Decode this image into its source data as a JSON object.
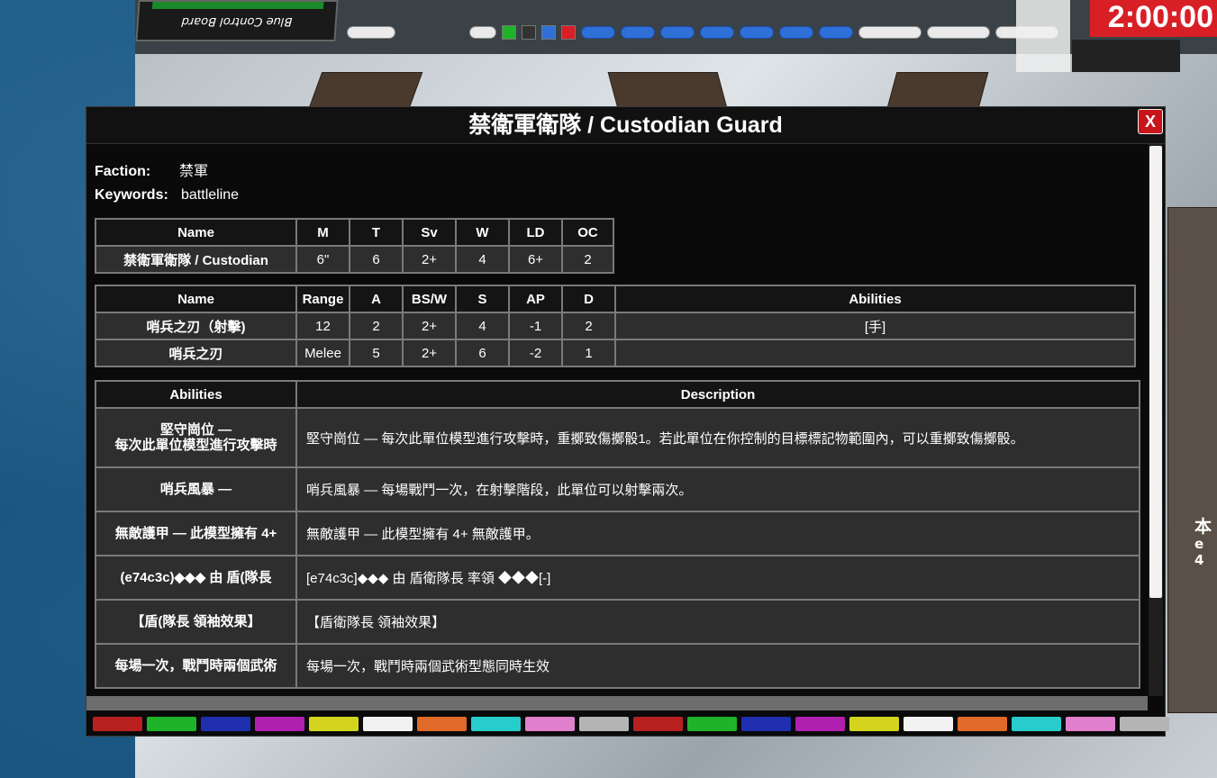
{
  "scene": {
    "control_board_label": "Blue Control Board",
    "timer": "2:00:00",
    "toolbar_pills": [
      "",
      "",
      "",
      "",
      "",
      ""
    ]
  },
  "modal": {
    "title": "禁衛軍衛隊 / Custodian Guard",
    "close_label": "X",
    "faction": {
      "key": "Faction:",
      "value": "禁軍"
    },
    "keywords": {
      "key": "Keywords:",
      "value": "battleline"
    },
    "profile_table": {
      "headers": [
        "Name",
        "M",
        "T",
        "Sv",
        "W",
        "LD",
        "OC"
      ],
      "rows": [
        [
          "禁衛軍衛隊 / Custodian",
          "6\"",
          "6",
          "2+",
          "4",
          "6+",
          "2"
        ]
      ]
    },
    "weapons_table": {
      "headers": [
        "Name",
        "Range",
        "A",
        "BS/W",
        "S",
        "AP",
        "D",
        "Abilities"
      ],
      "rows": [
        [
          "哨兵之刃（射擊)",
          "12",
          "2",
          "2+",
          "4",
          "-1",
          "2",
          "[手]"
        ],
        [
          "哨兵之刃",
          "Melee",
          "5",
          "2+",
          "6",
          "-2",
          "1",
          ""
        ]
      ]
    },
    "abilities_table": {
      "headers": [
        "Abilities",
        "Description"
      ],
      "rows": [
        {
          "name": "堅守崗位 —\n每次此單位模型進行攻擊時",
          "desc": "堅守崗位 — 每次此單位模型進行攻擊時，重擲致傷擲骰1。若此單位在你控制的目標標記物範圍內，可以重擲致傷擲骰。"
        },
        {
          "name": "哨兵風暴 —",
          "desc": "哨兵風暴 — 每場戰鬥一次，在射擊階段，此單位可以射擊兩次。"
        },
        {
          "name": "無敵護甲 — 此模型擁有 4+",
          "desc": "無敵護甲 — 此模型擁有 4+ 無敵護甲。"
        },
        {
          "name": "(e74c3c)◆◆◆ 由 盾(隊長",
          "desc": "[e74c3c]◆◆◆ 由 盾衛隊長 率領 ◆◆◆[-]"
        },
        {
          "name": "【盾(隊長 領袖效果】",
          "desc": "【盾衛隊長 領袖效果】"
        },
        {
          "name": "每場一次，戰鬥時兩個武術",
          "desc": "每場一次，戰鬥時兩個武術型態同時生效"
        }
      ]
    },
    "palette": [
      "#b82020",
      "#1fb32a",
      "#1f2fb0",
      "#b020b0",
      "#d4d41e",
      "#f2f2f2",
      "#e06a28",
      "#28cccc",
      "#e080cc",
      "#b4b4b4",
      "#b82020",
      "#1fb32a",
      "#1f2fb0",
      "#b020b0",
      "#d4d41e",
      "#f2f2f2",
      "#e06a28",
      "#28cccc",
      "#e080cc",
      "#b4b4b4"
    ]
  }
}
